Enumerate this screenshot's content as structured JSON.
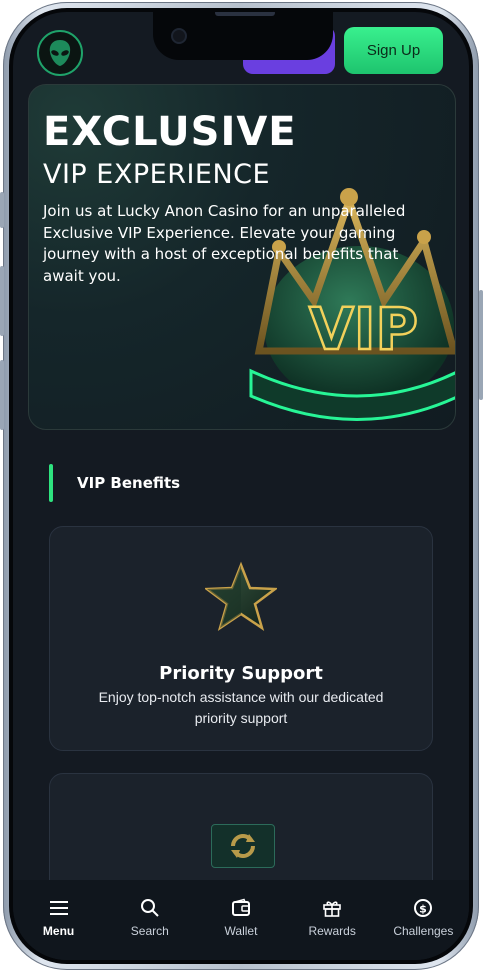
{
  "header": {
    "login_label": "",
    "signup_label": "Sign Up"
  },
  "hero": {
    "title": "EXCLUSIVE",
    "subtitle": "VIP EXPERIENCE",
    "description": "Join us at Lucky Anon Casino for an unparalleled Exclusive VIP Experience. Elevate your gaming journey with a host of exceptional benefits that await you.",
    "image_text": "VIP"
  },
  "benefits": {
    "section_title": "VIP Benefits",
    "cards": [
      {
        "title": "Priority Support",
        "description": "Enjoy top-notch assistance with our dedicated priority support",
        "icon": "star-icon"
      },
      {
        "title": "",
        "description": "",
        "icon": "card-refresh-icon"
      }
    ]
  },
  "bottom_nav": {
    "items": [
      {
        "label": "Menu",
        "icon": "menu-icon",
        "active": true
      },
      {
        "label": "Search",
        "icon": "search-icon",
        "active": false
      },
      {
        "label": "Wallet",
        "icon": "wallet-icon",
        "active": false
      },
      {
        "label": "Rewards",
        "icon": "gift-icon",
        "active": false
      },
      {
        "label": "Challenges",
        "icon": "coin-icon",
        "active": false
      }
    ]
  },
  "colors": {
    "accent_green": "#2ee37f",
    "accent_purple": "#6a3fe0",
    "background": "#141a22"
  }
}
